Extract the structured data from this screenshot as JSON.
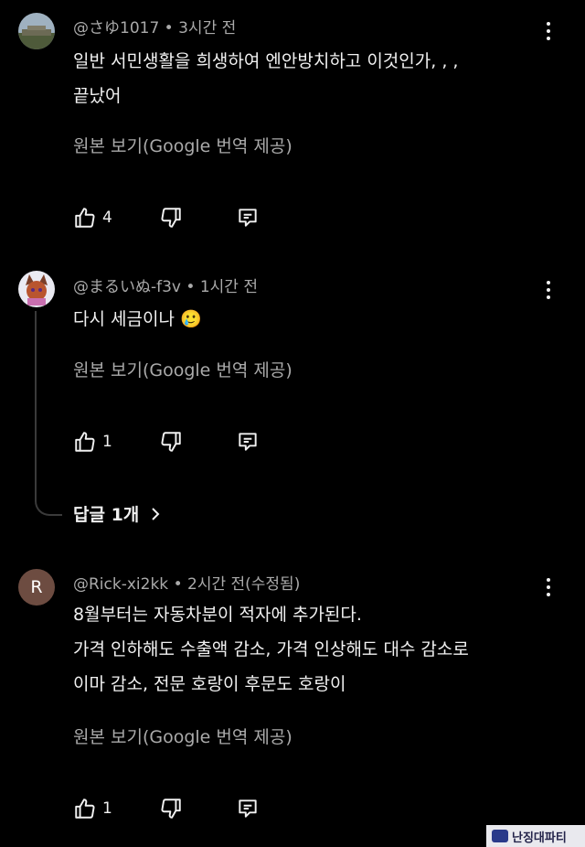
{
  "comments": [
    {
      "author": "@さゆ1017",
      "time": "3시간 전",
      "lines": [
        "일반 서민생활을 희생하여 엔안방치하고 이것인가, , ,",
        "끝났어"
      ],
      "translate": "원본 보기(Google 번역 제공)",
      "likes": "4"
    },
    {
      "author": "@まるいぬ-f3v",
      "time": "1시간 전",
      "lines": [
        "다시 세금이나 🥲"
      ],
      "translate": "원본 보기(Google 번역 제공)",
      "likes": "1"
    },
    {
      "author": "@Rick-xi2kk",
      "time": "2시간 전(수정됨)",
      "avatar_letter": "R",
      "lines": [
        "8월부터는 자동차분이 적자에 추가된다.",
        "가격 인하해도 수출액 감소, 가격 인상해도 대수 감소로",
        "이마 감소, 전문 호랑이 후문도 호랑이"
      ],
      "translate": "원본 보기(Google 번역 제공)",
      "likes": "1"
    }
  ],
  "replies_label": "답글 1개",
  "watermark": "난징대파티",
  "colors": {
    "background": "#000000",
    "text": "#f1f1f1",
    "muted": "#aaaaaa",
    "avatar_r": "#6d4c41"
  },
  "icons": [
    "like-icon",
    "dislike-icon",
    "reply-icon",
    "more-options-icon",
    "chevron-right-icon"
  ]
}
